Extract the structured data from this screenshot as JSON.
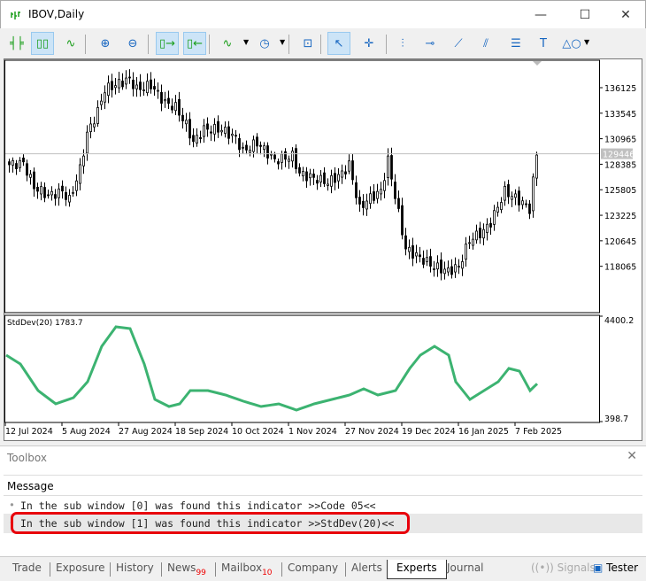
{
  "window": {
    "title": "IBOV,Daily",
    "minimize": "—",
    "maximize": "☐",
    "close": "✕"
  },
  "toolbar": {
    "icons": [
      "bar-chart-icon",
      "candlestick-icon",
      "line-chart-icon",
      "zoom-in-icon",
      "zoom-out-icon",
      "chart-shift-icon",
      "autoscroll-icon",
      "indicators-icon",
      "periods-icon",
      "screenshot-icon",
      "cursor-icon",
      "crosshair-icon",
      "vertical-line-icon",
      "horizontal-line-icon",
      "trendline-icon",
      "equidistant-channel-icon",
      "fibonacci-icon",
      "text-icon",
      "shapes-icon"
    ]
  },
  "chart": {
    "symbol": "IBOV",
    "timeframe": "Daily",
    "price_ticks": [
      "136125",
      "133545",
      "130965",
      "128385",
      "125805",
      "123225",
      "120645",
      "118065"
    ],
    "current_price": "129446",
    "indicator_label": "StdDev(20) 1783.7",
    "indicator_ticks": [
      "4400.2",
      "398.7"
    ],
    "date_ticks": [
      "12 Jul 2024",
      "5 Aug 2024",
      "27 Aug 2024",
      "18 Sep 2024",
      "10 Oct 2024",
      "1 Nov 2024",
      "27 Nov 2024",
      "19 Dec 2024",
      "16 Jan 2025",
      "7 Feb 2025"
    ],
    "colors": {
      "up": "#ffffff",
      "down": "#000000",
      "line": "#3cb371",
      "price_line": "#c0c0c0"
    }
  },
  "chart_data": {
    "type": "candlestick",
    "price_range": [
      115000,
      139000
    ],
    "bars": 150,
    "close_keypoints": [
      [
        0,
        128334
      ],
      [
        4,
        128513
      ],
      [
        7,
        126095
      ],
      [
        11,
        125200
      ],
      [
        15,
        125648
      ],
      [
        17,
        124752
      ],
      [
        20,
        127886
      ],
      [
        22,
        131468
      ],
      [
        25,
        133707
      ],
      [
        27,
        135946
      ],
      [
        30,
        136394
      ],
      [
        34,
        137020
      ],
      [
        36,
        135946
      ],
      [
        40,
        136394
      ],
      [
        44,
        134603
      ],
      [
        47,
        134155
      ],
      [
        50,
        132364
      ],
      [
        52,
        130573
      ],
      [
        55,
        131916
      ],
      [
        60,
        131916
      ],
      [
        64,
        131021
      ],
      [
        66,
        129677
      ],
      [
        70,
        130573
      ],
      [
        75,
        128782
      ],
      [
        80,
        129230
      ],
      [
        82,
        127439
      ],
      [
        86,
        126991
      ],
      [
        90,
        126543
      ],
      [
        94,
        127439
      ],
      [
        96,
        128334
      ],
      [
        99,
        123857
      ],
      [
        101,
        124752
      ],
      [
        105,
        125648
      ],
      [
        107,
        128782
      ],
      [
        110,
        123409
      ],
      [
        112,
        119827
      ],
      [
        116,
        118932
      ],
      [
        120,
        118036
      ],
      [
        124,
        117588
      ],
      [
        127,
        118036
      ],
      [
        130,
        120723
      ],
      [
        134,
        121618
      ],
      [
        136,
        122514
      ],
      [
        140,
        125648
      ],
      [
        144,
        124752
      ],
      [
        147,
        123857
      ],
      [
        149,
        129446
      ]
    ],
    "indicator": {
      "name": "StdDev(20)",
      "range": [
        398.7,
        4400.2
      ],
      "keypoints": [
        [
          0,
          2968
        ],
        [
          4,
          2601
        ],
        [
          9,
          1500
        ],
        [
          14,
          949
        ],
        [
          19,
          1206
        ],
        [
          23,
          1867
        ],
        [
          27,
          3336
        ],
        [
          31,
          4143
        ],
        [
          35,
          4070
        ],
        [
          39,
          2601
        ],
        [
          42,
          1133
        ],
        [
          46,
          839
        ],
        [
          49,
          949
        ],
        [
          52,
          1500
        ],
        [
          57,
          1500
        ],
        [
          62,
          1317
        ],
        [
          67,
          1060
        ],
        [
          72,
          839
        ],
        [
          77,
          949
        ],
        [
          82,
          692
        ],
        [
          87,
          949
        ],
        [
          92,
          1133
        ],
        [
          97,
          1317
        ],
        [
          101,
          1574
        ],
        [
          105,
          1317
        ],
        [
          110,
          1500
        ],
        [
          114,
          2418
        ],
        [
          117,
          2968
        ],
        [
          121,
          3336
        ],
        [
          125,
          2968
        ],
        [
          127,
          1867
        ],
        [
          131,
          1133
        ],
        [
          135,
          1500
        ],
        [
          139,
          1867
        ],
        [
          142,
          2418
        ],
        [
          145,
          2308
        ],
        [
          148,
          1500
        ],
        [
          150,
          1783.7
        ]
      ]
    }
  },
  "toolbox": {
    "title": "Toolbox",
    "close": "✕",
    "column": "Message",
    "messages": [
      "In the sub window [0] was found this indicator >>Code 05<<",
      "In the sub window [1] was found this indicator >>StdDev(20)<<"
    ],
    "highlight_color": "#e8000b"
  },
  "tabs": [
    {
      "label": "Trade"
    },
    {
      "label": "Exposure"
    },
    {
      "label": "History"
    },
    {
      "label": "News",
      "badge": "99"
    },
    {
      "label": "Mailbox",
      "badge": "10"
    },
    {
      "label": "Company"
    },
    {
      "label": "Alerts"
    },
    {
      "label": "Experts",
      "active": true
    },
    {
      "label": "Journal"
    }
  ],
  "right_tabs": {
    "signals": "Signals",
    "tester": "Tester"
  }
}
